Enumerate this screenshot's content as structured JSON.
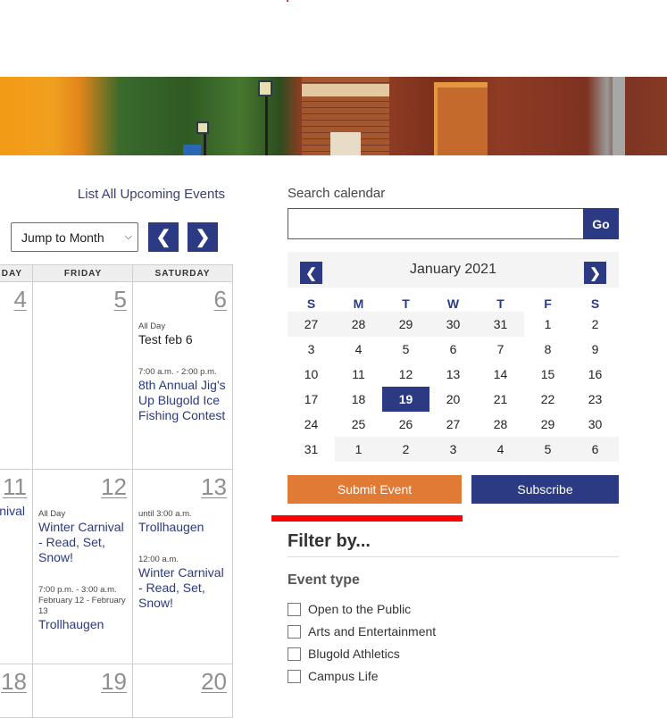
{
  "hero": {
    "alt": "Campus buildings at sunset"
  },
  "calendar": {
    "list_all_label": "List All Upcoming Events",
    "jump_select": {
      "selected": "Jump to Month"
    },
    "prev_label": "❮",
    "next_label": "❯",
    "headers": [
      "DAY",
      "FRIDAY",
      "SATURDAY"
    ],
    "weeks": [
      {
        "days": [
          {
            "num": "4",
            "events": []
          },
          {
            "num": "5",
            "events": []
          },
          {
            "num": "6",
            "events": [
              {
                "time": "All Day",
                "name": "Test feb 6",
                "linked": false
              },
              {
                "time": "7:00 a.m. - 2:00 p.m.",
                "name": "8th Annual Jig's Up Blugold Ice Fishing Contest",
                "linked": true
              }
            ]
          }
        ]
      },
      {
        "days": [
          {
            "num": "11",
            "events": [
              {
                "time": "",
                "name": "nival",
                "linked": true
              }
            ]
          },
          {
            "num": "12",
            "events": [
              {
                "time": "All Day",
                "name": "Winter Carnival - Read, Set, Snow!",
                "linked": true
              },
              {
                "time": "7:00 p.m. - 3:00 a.m. February 12 - February 13",
                "name": "Trollhaugen",
                "linked": true
              }
            ]
          },
          {
            "num": "13",
            "events": [
              {
                "time": "until 3:00 a.m.",
                "name": "Trollhaugen",
                "linked": true
              },
              {
                "time": "12:00 a.m.",
                "name": "Winter Carnival - Read, Set, Snow!",
                "linked": true
              }
            ]
          }
        ]
      },
      {
        "days": [
          {
            "num": "18",
            "events": []
          },
          {
            "num": "19",
            "events": []
          },
          {
            "num": "20",
            "events": []
          }
        ]
      }
    ]
  },
  "search": {
    "label": "Search calendar",
    "value": "",
    "placeholder": "",
    "go_label": "Go"
  },
  "mini_calendar": {
    "month_label": "January 2021",
    "prev_label": "❮",
    "next_label": "❯",
    "dow": [
      "S",
      "M",
      "T",
      "W",
      "T",
      "F",
      "S"
    ],
    "today": "19",
    "weeks": [
      [
        {
          "d": "27",
          "o": true
        },
        {
          "d": "28",
          "o": true
        },
        {
          "d": "29",
          "o": true
        },
        {
          "d": "30",
          "o": true
        },
        {
          "d": "31",
          "o": true
        },
        {
          "d": "1",
          "o": false
        },
        {
          "d": "2",
          "o": false
        }
      ],
      [
        {
          "d": "3",
          "o": false
        },
        {
          "d": "4",
          "o": false
        },
        {
          "d": "5",
          "o": false
        },
        {
          "d": "6",
          "o": false
        },
        {
          "d": "7",
          "o": false
        },
        {
          "d": "8",
          "o": false
        },
        {
          "d": "9",
          "o": false
        }
      ],
      [
        {
          "d": "10",
          "o": false
        },
        {
          "d": "11",
          "o": false
        },
        {
          "d": "12",
          "o": false
        },
        {
          "d": "13",
          "o": false
        },
        {
          "d": "14",
          "o": false
        },
        {
          "d": "15",
          "o": false
        },
        {
          "d": "16",
          "o": false
        }
      ],
      [
        {
          "d": "17",
          "o": false
        },
        {
          "d": "18",
          "o": false
        },
        {
          "d": "19",
          "o": false,
          "t": true
        },
        {
          "d": "20",
          "o": false
        },
        {
          "d": "21",
          "o": false
        },
        {
          "d": "22",
          "o": false
        },
        {
          "d": "23",
          "o": false
        }
      ],
      [
        {
          "d": "24",
          "o": false
        },
        {
          "d": "25",
          "o": false
        },
        {
          "d": "26",
          "o": false
        },
        {
          "d": "27",
          "o": false
        },
        {
          "d": "28",
          "o": false
        },
        {
          "d": "29",
          "o": false
        },
        {
          "d": "30",
          "o": false
        }
      ],
      [
        {
          "d": "31",
          "o": false
        },
        {
          "d": "1",
          "o": true
        },
        {
          "d": "2",
          "o": true
        },
        {
          "d": "3",
          "o": true
        },
        {
          "d": "4",
          "o": true
        },
        {
          "d": "5",
          "o": true
        },
        {
          "d": "6",
          "o": true
        }
      ]
    ]
  },
  "actions": {
    "submit_label": "Submit Event",
    "subscribe_label": "Subscribe"
  },
  "filter": {
    "title": "Filter by...",
    "event_type_label": "Event type",
    "options": [
      {
        "label": "Open to the Public",
        "checked": false
      },
      {
        "label": "Arts and Entertainment",
        "checked": false
      },
      {
        "label": "Blugold Athletics",
        "checked": false
      },
      {
        "label": "Campus Life",
        "checked": false
      }
    ]
  },
  "colors": {
    "brand_blue": "#2b3a82",
    "accent_orange": "#e07a34",
    "highlight_red": "#ff0000"
  }
}
